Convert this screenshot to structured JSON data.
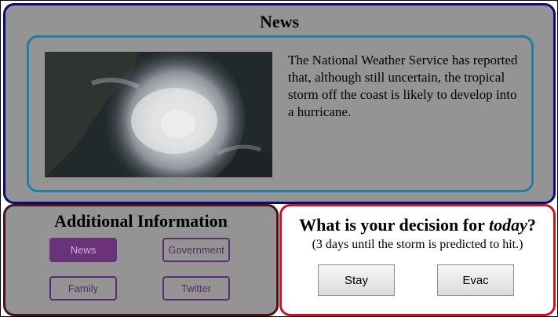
{
  "news": {
    "title": "News",
    "image_alt": "satellite image of tropical storm",
    "body": "The National Weather Service has reported that, although still uncertain, the tropical storm off the coast is likely to develop into a hurricane."
  },
  "additional_info": {
    "title": "Additional Information",
    "buttons": [
      {
        "label": "News",
        "active": true
      },
      {
        "label": "Government",
        "active": false
      },
      {
        "label": "Family",
        "active": false
      },
      {
        "label": "Twitter",
        "active": false
      }
    ]
  },
  "decision": {
    "question_prefix": "What is your decision for ",
    "question_emphasis": "today",
    "question_suffix": "?",
    "subtitle": "(3 days until the storm is predicted to hit.)",
    "stay_label": "Stay",
    "evac_label": "Evac"
  },
  "colors": {
    "panel_overlay": "#949494",
    "news_border": "#0a0a78",
    "card_border": "#1f7fa6",
    "info_border": "#4a1414",
    "decision_border": "#c8141e",
    "button_purple": "#6a3278"
  }
}
